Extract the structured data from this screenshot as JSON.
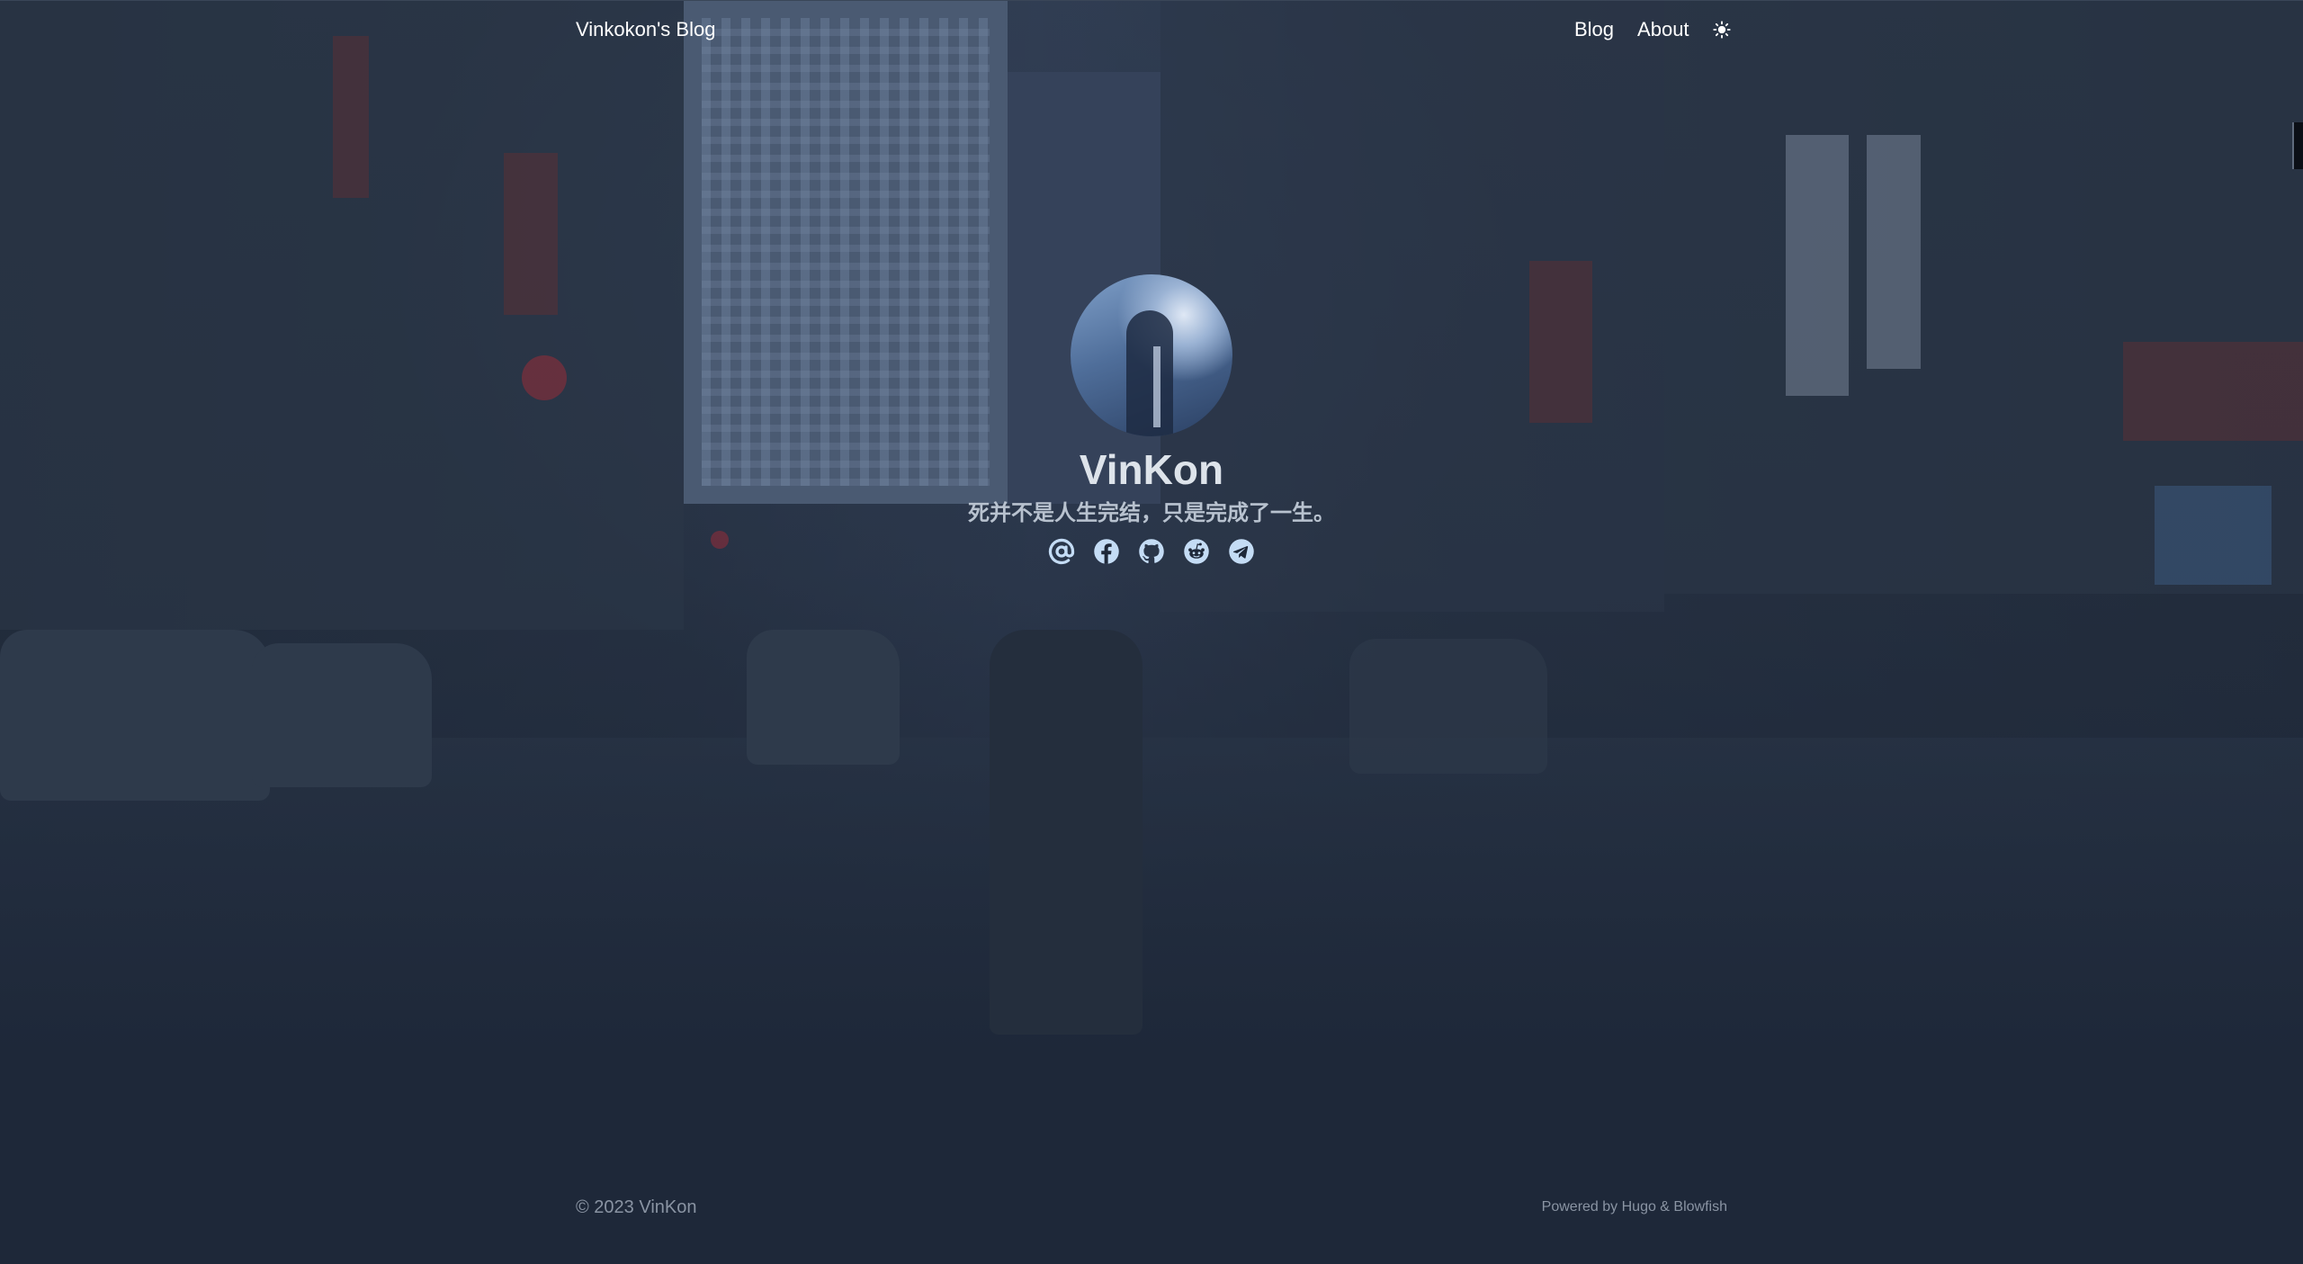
{
  "header": {
    "site_title": "Vinkokon's Blog",
    "nav": [
      {
        "label": "Blog"
      },
      {
        "label": "About"
      }
    ],
    "theme_toggle_icon": "sun-icon"
  },
  "profile": {
    "avatar_icon": "avatar",
    "name": "VinKon",
    "motto": "死并不是人生完结，只是完成了一生。",
    "socials": [
      {
        "icon": "at-sign-icon"
      },
      {
        "icon": "facebook-icon"
      },
      {
        "icon": "github-icon"
      },
      {
        "icon": "reddit-icon"
      },
      {
        "icon": "telegram-icon"
      }
    ]
  },
  "footer": {
    "copyright": "© 2023 VinKon",
    "powered_prefix": "Powered by ",
    "hugo": "Hugo",
    "amp": " & ",
    "blowfish": "Blowfish"
  },
  "colors": {
    "background": "#1e2839",
    "text_primary": "#ffffff",
    "text_muted": "#8a94a3",
    "icon_accent": "#c4dcf5"
  }
}
